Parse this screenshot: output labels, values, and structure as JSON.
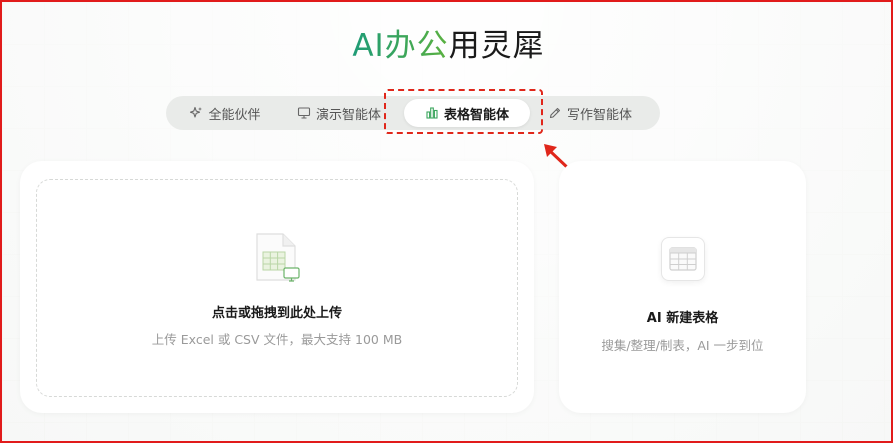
{
  "header": {
    "brand": "AI办公",
    "rest": "用灵犀"
  },
  "tabs": [
    {
      "label": "全能伙伴",
      "icon": "sparkle-icon",
      "active": false
    },
    {
      "label": "演示智能体",
      "icon": "presentation-icon",
      "active": false
    },
    {
      "label": "表格智能体",
      "icon": "bar-chart-icon",
      "active": true
    },
    {
      "label": "写作智能体",
      "icon": "pencil-icon",
      "active": false
    }
  ],
  "upload": {
    "title": "点击或拖拽到此处上传",
    "subtitle": "上传 Excel 或 CSV 文件，最大支持 100 MB"
  },
  "new_sheet": {
    "title": "AI 新建表格",
    "subtitle": "搜集/整理/制表，AI 一步到位"
  },
  "colors": {
    "accent_green": "#3aa55c",
    "annotation_red": "#e0271b"
  }
}
